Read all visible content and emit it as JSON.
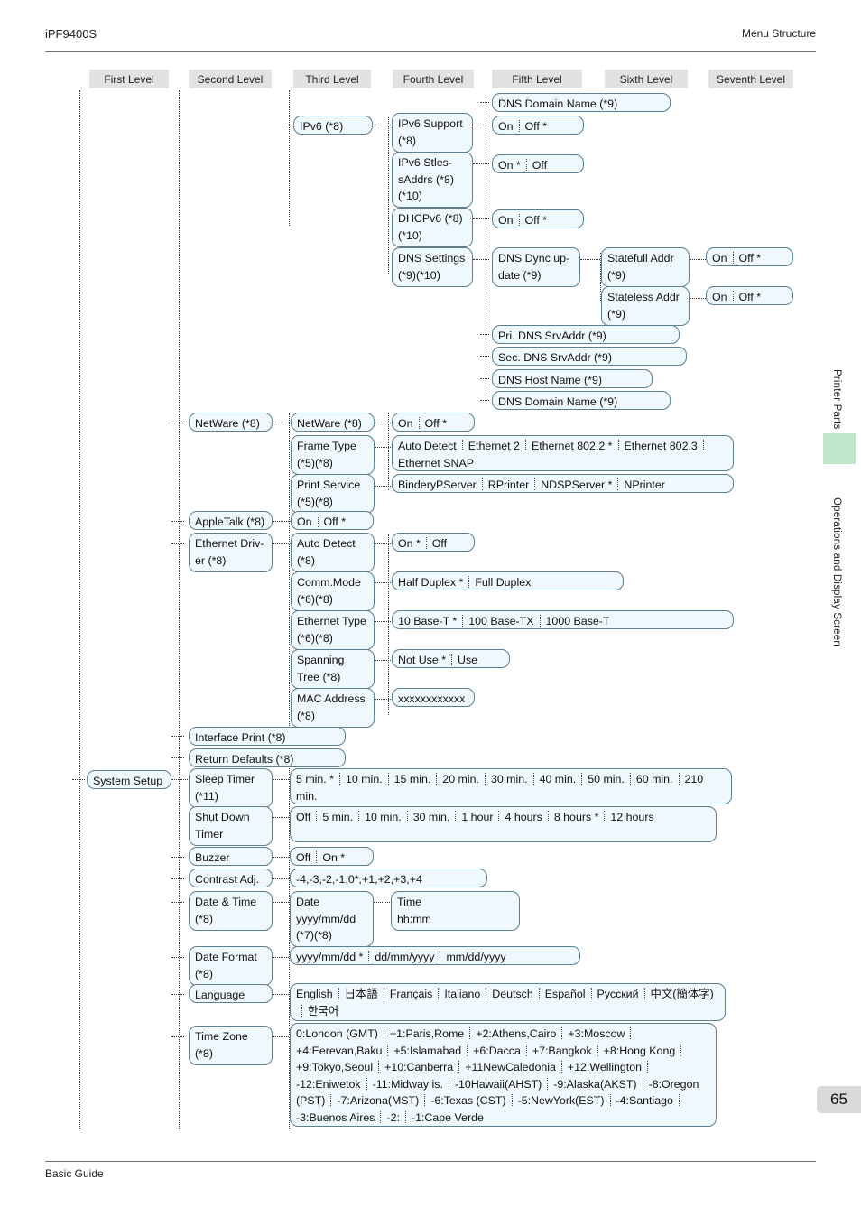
{
  "header": {
    "model": "iPF9400S",
    "section": "Menu Structure"
  },
  "footer": {
    "guide": "Basic Guide",
    "page_number": "65"
  },
  "side_tabs": [
    {
      "label": "Printer Parts",
      "active": false
    },
    {
      "label": "Operations and Display Screen",
      "active": true
    }
  ],
  "accent_colors": {
    "tab_highlight": "#bfe7c9",
    "node_fill": "#eff8fd",
    "node_border": "#5b7f93",
    "level_chip": "#e2e2e2",
    "page_tab": "#d9d9d9"
  },
  "level_headers": [
    "First Level",
    "Second Level",
    "Third Level",
    "Fourth Level",
    "Fifth Level",
    "Sixth Level",
    "Seventh Level"
  ],
  "nodes": {
    "dns_domain_name_top": "DNS Domain Name (*9)",
    "ipv6": "IPv6 (*8)",
    "ipv6_support": "IPv6 Support\n(*8)",
    "ipv6_support_opts": [
      "On",
      "Off *"
    ],
    "ipv6_stless": "IPv6 Stles-\nsAddrs (*8)\n(*10)",
    "ipv6_stless_opts": [
      "On *",
      "Off"
    ],
    "dhcpv6": "DHCPv6 (*8)\n(*10)",
    "dhcpv6_opts": [
      "On",
      "Off *"
    ],
    "dns_settings": "DNS Settings\n(*9)(*10)",
    "dns_dync_update": "DNS Dync up-\ndate (*9)",
    "statefull_addr": "Statefull Addr\n(*9)",
    "statefull_opts": [
      "On",
      "Off *"
    ],
    "stateless_addr": "Stateless Addr\n(*9)",
    "stateless_opts": [
      "On",
      "Off *"
    ],
    "pri_dns": "Pri. DNS SrvAddr (*9)",
    "sec_dns": "Sec. DNS SrvAddr (*9)",
    "dns_host_name": "DNS Host Name (*9)",
    "dns_domain_name": "DNS Domain Name (*9)",
    "netware_l2": "NetWare (*8)",
    "netware_l3": "NetWare (*8)",
    "netware_opts": [
      "On",
      "Off *"
    ],
    "frame_type": "Frame Type\n(*5)(*8)",
    "frame_type_opts": [
      "Auto Detect",
      "Ethernet 2",
      "Ethernet 802.2 *",
      "Ethernet 802.3",
      "Ethernet SNAP"
    ],
    "print_service": "Print Service\n(*5)(*8)",
    "print_service_opts": [
      "BinderyPServer",
      "RPrinter",
      "NDSPServer *",
      "NPrinter"
    ],
    "appletalk": "AppleTalk (*8)",
    "appletalk_opts": [
      "On",
      "Off *"
    ],
    "ethernet_driver": "Ethernet Driv-\ner (*8)",
    "auto_detect": "Auto Detect\n(*8)",
    "auto_detect_opts": [
      "On *",
      "Off"
    ],
    "comm_mode": "Comm.Mode\n(*6)(*8)",
    "comm_mode_opts": [
      "Half Duplex *",
      "Full Duplex"
    ],
    "ethernet_type": "Ethernet Type\n(*6)(*8)",
    "ethernet_type_opts": [
      "10 Base-T *",
      "100 Base-TX",
      "1000 Base-T"
    ],
    "spanning_tree": "Spanning\nTree (*8)",
    "spanning_tree_opts": [
      "Not Use *",
      "Use"
    ],
    "mac_address": "MAC Address\n(*8)",
    "mac_address_opts": [
      "xxxxxxxxxxxx"
    ],
    "interface_print": "Interface Print (*8)",
    "return_defaults": "Return Defaults (*8)",
    "system_setup": "System Setup",
    "sleep_timer": "Sleep Timer\n(*11)",
    "sleep_timer_opts": [
      "5 min. *",
      "10 min.",
      "15 min.",
      "20 min.",
      "30 min.",
      "40 min.",
      "50 min.",
      "60 min.",
      "210 min."
    ],
    "shut_down_timer": "Shut Down\nTimer",
    "shut_down_timer_opts": [
      "Off",
      "5 min.",
      "10 min.",
      "30 min.",
      "1 hour",
      "4 hours",
      "8 hours *",
      "12 hours"
    ],
    "buzzer": "Buzzer",
    "buzzer_opts": [
      "Off",
      "On *"
    ],
    "contrast_adj": "Contrast Adj.",
    "contrast_adj_opts": [
      "-4,-3,-2,-1,0*,+1,+2,+3,+4"
    ],
    "date_time": "Date & Time\n(*8)",
    "date": "Date\nyyyy/mm/dd\n(*7)(*8)",
    "time": "Time\nhh:mm",
    "date_format": "Date Format\n(*8)",
    "date_format_opts": [
      "yyyy/mm/dd *",
      "dd/mm/yyyy",
      "mm/dd/yyyy"
    ],
    "language": "Language",
    "language_opts": [
      "English",
      "日本語",
      "Français",
      "Italiano",
      "Deutsch",
      "Español",
      "Русский",
      "中文(簡体字)",
      "한국어"
    ],
    "time_zone": "Time Zone\n(*8)",
    "time_zone_opts": [
      "0:London (GMT)",
      "+1:Paris,Rome",
      "+2:Athens,Cairo",
      "+3:Moscow",
      "+4:Eerevan,Baku",
      "+5:Islamabad",
      "+6:Dacca",
      "+7:Bangkok",
      "+8:Hong Kong",
      "+9:Tokyo,Seoul",
      "+10:Canberra",
      "+11NewCaledonia",
      "+12:Wellington",
      "-12:Eniwetok",
      "-11:Midway is.",
      "-10Hawaii(AHST)",
      "-9:Alaska(AKST)",
      "-8:Oregon (PST)",
      "-7:Arizona(MST)",
      "-6:Texas (CST)",
      "-5:NewYork(EST)",
      "-4:Santiago",
      "-3:Buenos Aires",
      "-2:",
      "-1:Cape Verde"
    ]
  }
}
